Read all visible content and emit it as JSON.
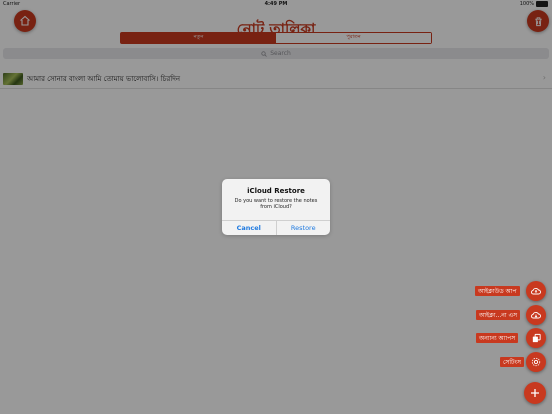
{
  "status": {
    "carrier": "Carrier",
    "time": "4:49 PM",
    "battery": "100%"
  },
  "header": {
    "title": "নোট তালিকা",
    "home_icon": "home-icon",
    "delete_icon": "trash-icon"
  },
  "segment": {
    "items": [
      "নতুন",
      "পুরাতন"
    ],
    "selected": "নতুন"
  },
  "search": {
    "placeholder": "Search"
  },
  "notes": [
    {
      "text": "আমার সোনার বাংলা আমি তোমায় ভালোবাসি। চিরদিন"
    }
  ],
  "alert": {
    "title": "iCloud Restore",
    "message": "Do you want to restore the notes from iCloud?",
    "cancel": "Cancel",
    "confirm": "Restore"
  },
  "fab_menu": [
    {
      "label": "আইক্লাউড আপ",
      "icon": "cloud-upload-icon"
    },
    {
      "label": "আইক্লা...না এস",
      "icon": "cloud-download-icon"
    },
    {
      "label": "অন্যান্য অ্যাপস",
      "icon": "copy-icon"
    },
    {
      "label": "সেটিংস",
      "icon": "gear-icon"
    }
  ],
  "fab_main_icon": "plus-icon",
  "colors": {
    "accent": "#c8391f",
    "link": "#1f7ae0"
  }
}
